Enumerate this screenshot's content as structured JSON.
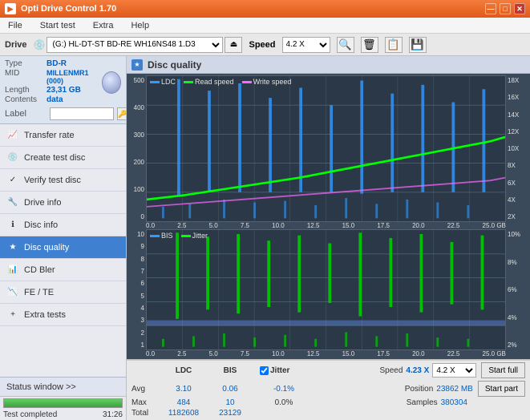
{
  "app": {
    "title": "Opti Drive Control 1.70",
    "icon": "ODC"
  },
  "titlebar": {
    "minimize": "—",
    "maximize": "□",
    "close": "✕"
  },
  "menubar": {
    "items": [
      "File",
      "Start test",
      "Extra",
      "Help"
    ]
  },
  "drivebar": {
    "label": "Drive",
    "drive_value": "(G:)  HL-DT-ST BD-RE  WH16NS48 1.D3",
    "speed_label": "Speed",
    "speed_value": "4.2 X"
  },
  "disc": {
    "type_label": "Type",
    "type_value": "BD-R",
    "mid_label": "MID",
    "mid_value": "MILLENMR1 (000)",
    "length_label": "Length",
    "length_value": "23,31 GB",
    "contents_label": "Contents",
    "contents_value": "data",
    "label_label": "Label"
  },
  "sidebar_items": [
    {
      "id": "transfer-rate",
      "label": "Transfer rate",
      "icon": "📈"
    },
    {
      "id": "create-test-disc",
      "label": "Create test disc",
      "icon": "💿"
    },
    {
      "id": "verify-test-disc",
      "label": "Verify test disc",
      "icon": "✓"
    },
    {
      "id": "drive-info",
      "label": "Drive info",
      "icon": "🔧"
    },
    {
      "id": "disc-info",
      "label": "Disc info",
      "icon": "ℹ"
    },
    {
      "id": "disc-quality",
      "label": "Disc quality",
      "icon": "★",
      "active": true
    },
    {
      "id": "cd-bler",
      "label": "CD Bler",
      "icon": "📊"
    },
    {
      "id": "fe-te",
      "label": "FE / TE",
      "icon": "📉"
    },
    {
      "id": "extra-tests",
      "label": "Extra tests",
      "icon": "+"
    }
  ],
  "status": {
    "window_label": "Status window >>",
    "progress": 100,
    "status_text": "Test completed",
    "time": "31:26"
  },
  "content": {
    "title": "Disc quality",
    "chart1": {
      "legend": [
        "LDC",
        "Read speed",
        "Write speed"
      ],
      "legend_colors": [
        "#3399ff",
        "#00ff00",
        "#ff66ff"
      ],
      "y_labels_left": [
        "500",
        "400",
        "300",
        "200",
        "100",
        "0"
      ],
      "y_labels_right": [
        "18X",
        "16X",
        "14X",
        "12X",
        "10X",
        "8X",
        "6X",
        "4X",
        "2X"
      ],
      "x_labels": [
        "0.0",
        "2.5",
        "5.0",
        "7.5",
        "10.0",
        "12.5",
        "15.0",
        "17.5",
        "20.0",
        "22.5",
        "25.0 GB"
      ]
    },
    "chart2": {
      "legend": [
        "BIS",
        "Jitter"
      ],
      "legend_colors": [
        "#3399ff",
        "#00ff00"
      ],
      "y_labels_left": [
        "10",
        "9",
        "8",
        "7",
        "6",
        "5",
        "4",
        "3",
        "2",
        "1"
      ],
      "y_labels_right": [
        "10%",
        "8%",
        "6%",
        "4%",
        "2%"
      ],
      "x_labels": [
        "0.0",
        "2.5",
        "5.0",
        "7.5",
        "10.0",
        "12.5",
        "15.0",
        "17.5",
        "20.0",
        "22.5",
        "25.0 GB"
      ]
    }
  },
  "stats": {
    "col_headers": [
      "LDC",
      "BIS",
      "",
      "Jitter",
      "Speed",
      ""
    ],
    "avg_label": "Avg",
    "avg_ldc": "3.10",
    "avg_bis": "0.06",
    "avg_jitter": "-0.1%",
    "max_label": "Max",
    "max_ldc": "484",
    "max_bis": "10",
    "max_jitter": "0.0%",
    "total_label": "Total",
    "total_ldc": "1182608",
    "total_bis": "23129",
    "speed_label": "Speed",
    "speed_value": "4.23 X",
    "speed_select": "4.2 X",
    "position_label": "Position",
    "position_value": "23862 MB",
    "samples_label": "Samples",
    "samples_value": "380304",
    "start_full_label": "Start full",
    "start_part_label": "Start part",
    "jitter_checked": true
  }
}
